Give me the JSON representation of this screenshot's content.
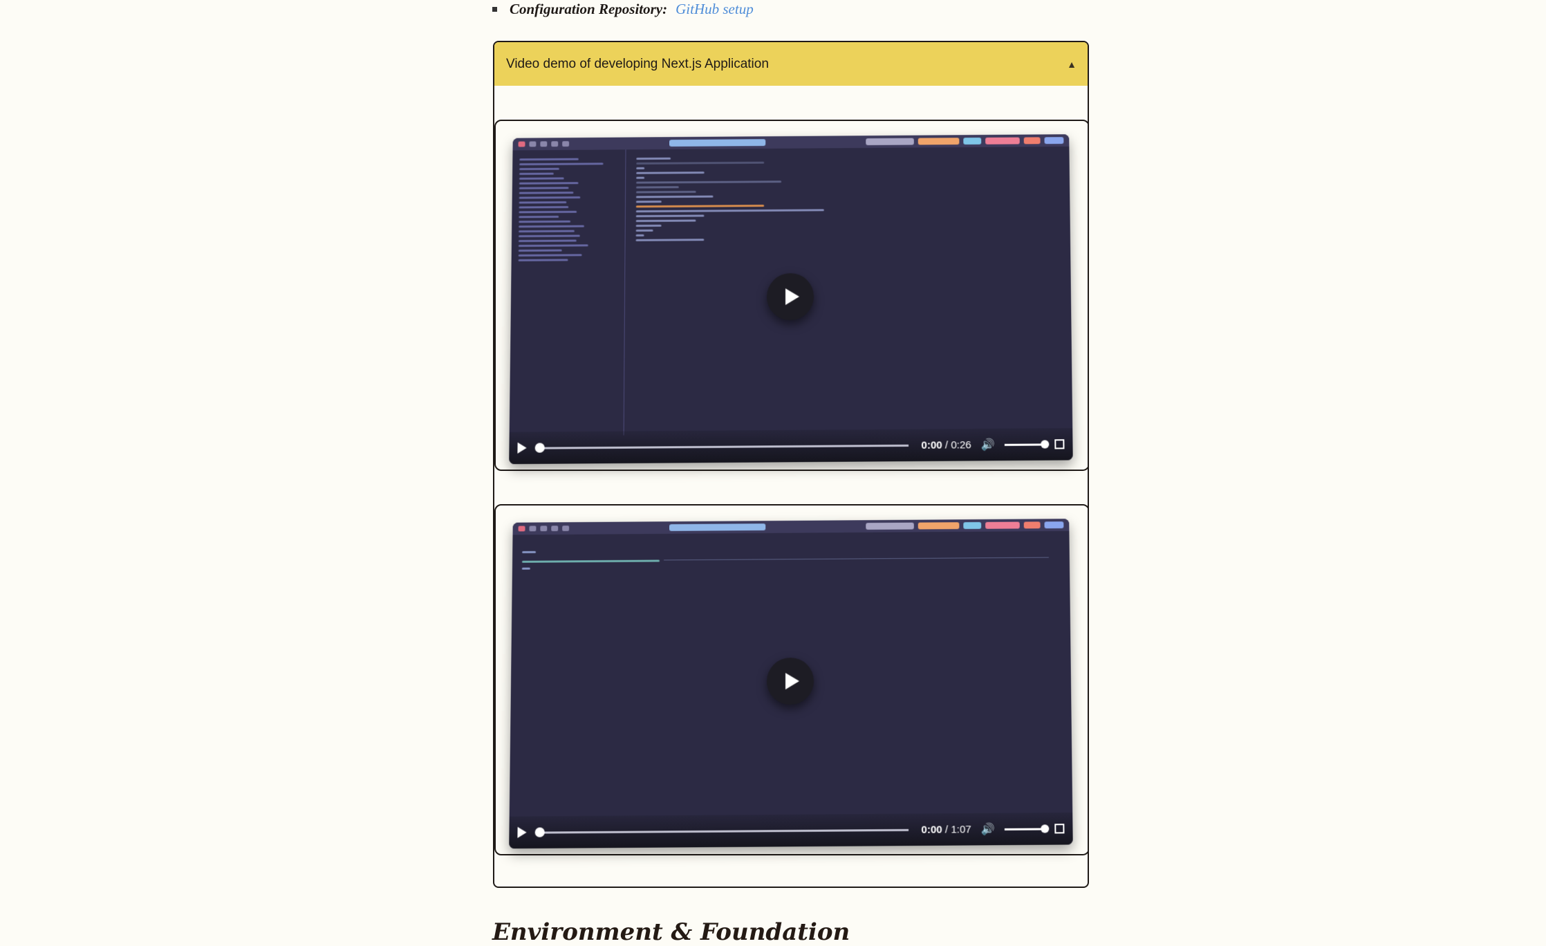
{
  "config": {
    "label": "Configuration Repository:",
    "link": "GitHub setup"
  },
  "accordion": {
    "title": "Video demo of developing Next.js Application",
    "toggle_icon": "▲"
  },
  "videos": [
    {
      "current": "0:00",
      "duration": "0:26"
    },
    {
      "current": "0:00",
      "duration": "1:07"
    }
  ],
  "section_heading": "Environment & Foundation",
  "colors": {
    "accordion_header": "#ecd25a",
    "link": "#4f8dd8",
    "background": "#fdfcf6"
  }
}
